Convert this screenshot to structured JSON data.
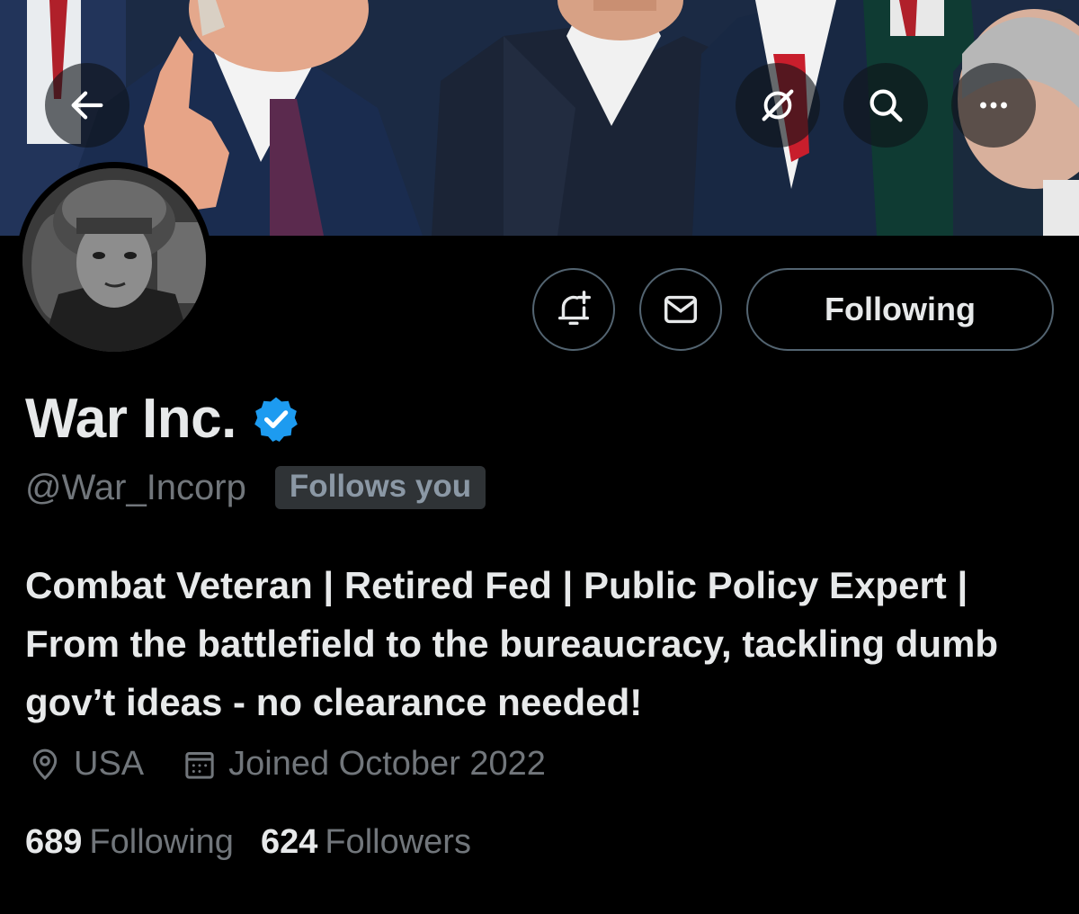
{
  "header": {
    "back_icon": "arrow-left-icon",
    "grok_icon": "grok-icon",
    "search_icon": "search-icon",
    "more_icon": "more-horizontal-icon"
  },
  "actions": {
    "notify_icon": "bell-plus-icon",
    "message_icon": "envelope-icon",
    "following_label": "Following"
  },
  "profile": {
    "display_name": "War Inc.",
    "verified": true,
    "verified_color": "#1d9bf0",
    "handle": "@War_Incorp",
    "follows_you_label": "Follows you",
    "bio": "Combat Veteran | Retired Fed | Public Policy Expert | From the battlefield to the bureaucracy, tackling dumb gov’t ideas - no clearance needed!",
    "location": "USA",
    "joined": "Joined October 2022"
  },
  "stats": {
    "following_count": "689",
    "following_label": "Following",
    "followers_count": "624",
    "followers_label": "Followers"
  },
  "colors": {
    "background": "#000000",
    "primary_text": "#e7e9ea",
    "secondary_text": "#71767b",
    "border": "#536471",
    "badge_bg": "#2f3336"
  }
}
